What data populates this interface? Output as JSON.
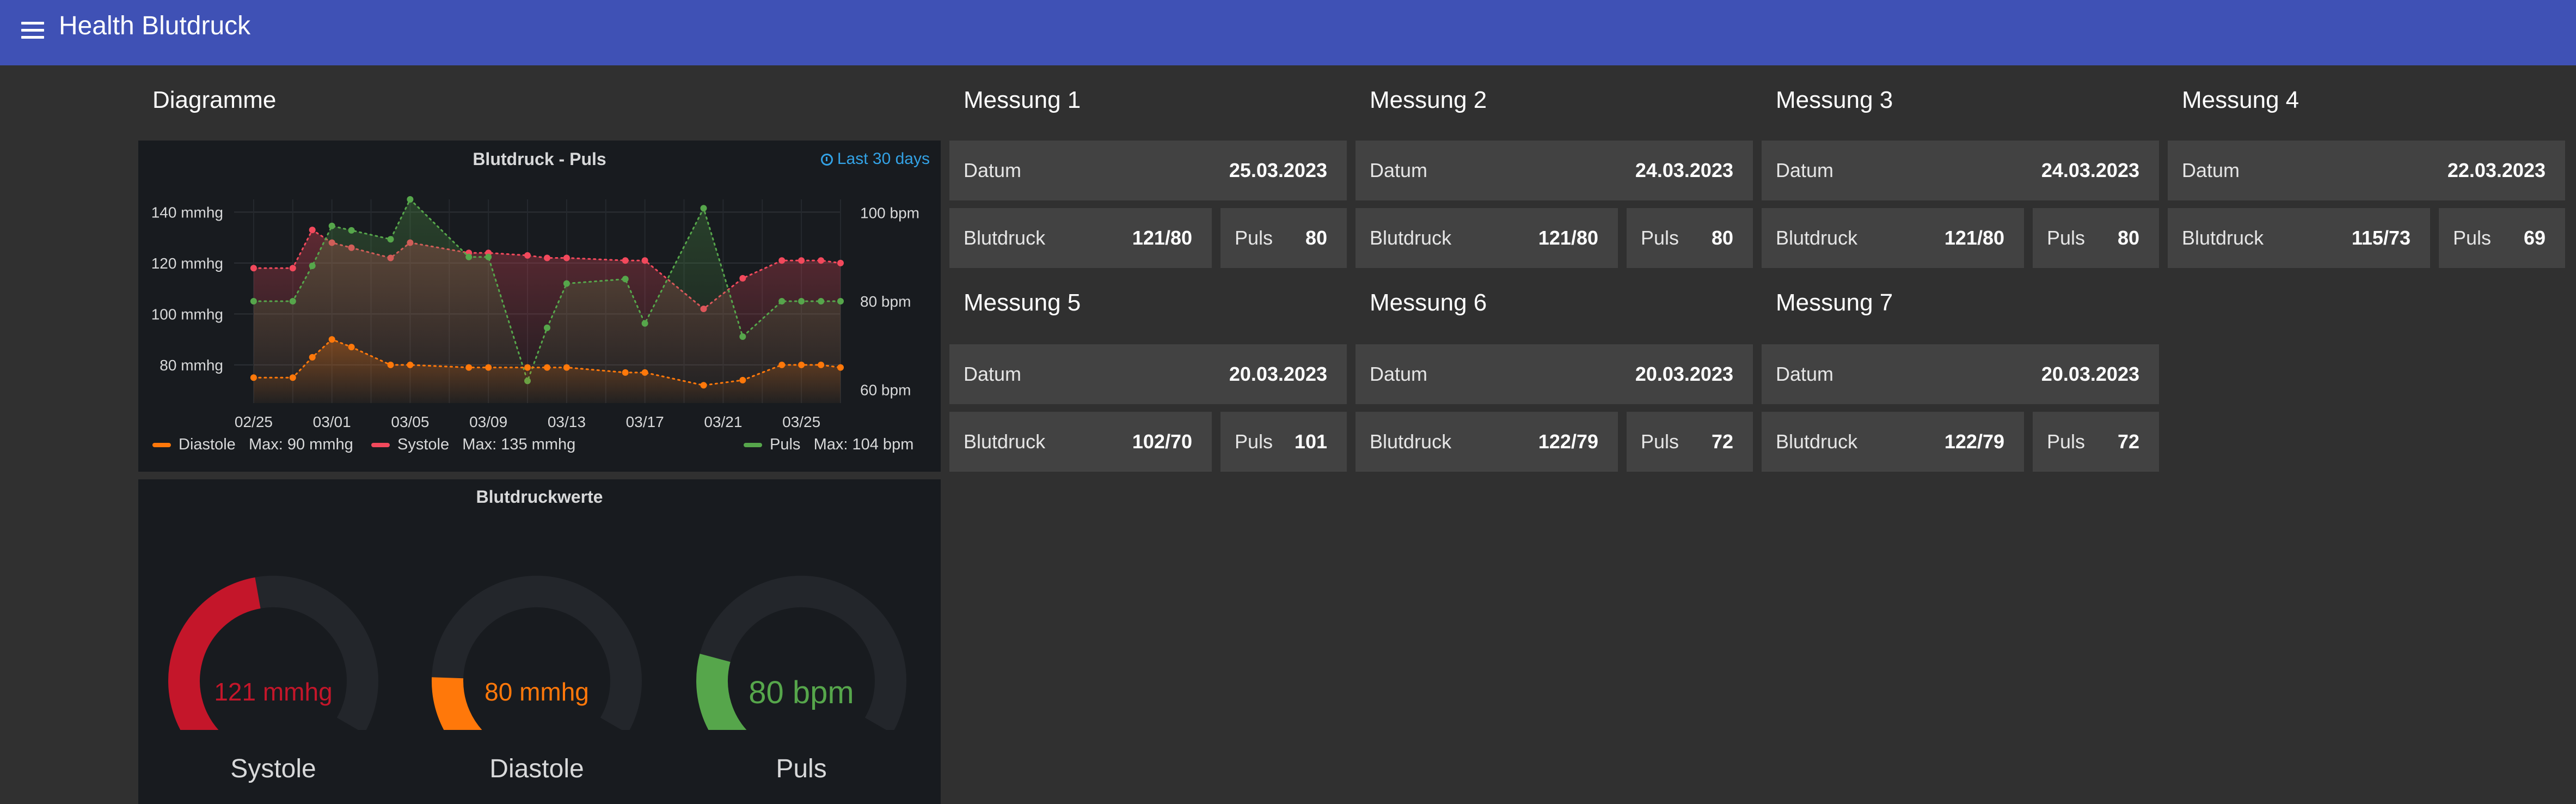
{
  "header": {
    "title": "Health Blutdruck",
    "menu_icon": "menu-icon",
    "color": "#3f51b5"
  },
  "section": {
    "diagrams_title": "Diagramme"
  },
  "chart_panel": {
    "title": "Blutdruck - Puls",
    "time_range": "Last 30 days",
    "legend": [
      {
        "name": "Diastole",
        "max_label": "Max: 90 mmhg",
        "color": "#ff780a"
      },
      {
        "name": "Systole",
        "max_label": "Max: 135 mmhg",
        "color": "#f2495c"
      },
      {
        "name": "Puls",
        "max_label": "Max: 104 bpm",
        "color": "#56a64b"
      }
    ]
  },
  "chart_data": {
    "type": "line",
    "title": "Blutdruck - Puls",
    "x_ticks": [
      "02/25",
      "03/01",
      "03/05",
      "03/09",
      "03/13",
      "03/17",
      "03/21",
      "03/25"
    ],
    "y_left_ticks": [
      "140 mmhg",
      "120 mmhg",
      "100 mmhg",
      "80 mmhg"
    ],
    "y_right_ticks": [
      "100 bpm",
      "80 bpm",
      "60 bpm"
    ],
    "y_left_range": [
      65,
      145
    ],
    "y_right_range": [
      57,
      103
    ],
    "x": [
      "2023-02-25",
      "2023-02-27",
      "2023-02-28",
      "2023-03-01",
      "2023-03-02",
      "2023-03-04",
      "2023-03-05",
      "2023-03-08",
      "2023-03-09",
      "2023-03-11",
      "2023-03-12",
      "2023-03-13",
      "2023-03-16",
      "2023-03-17",
      "2023-03-20",
      "2023-03-22",
      "2023-03-24",
      "2023-03-25",
      "2023-03-26",
      "2023-03-27"
    ],
    "series": [
      {
        "name": "Systole",
        "axis": "left",
        "color": "#f2495c",
        "values": [
          118,
          118,
          133,
          128,
          126,
          122,
          128,
          124,
          124,
          123,
          122,
          122,
          121,
          121,
          102,
          114,
          121,
          121,
          121,
          120
        ]
      },
      {
        "name": "Diastole",
        "axis": "left",
        "color": "#ff780a",
        "values": [
          75,
          75,
          83,
          90,
          87,
          80,
          80,
          79,
          79,
          79,
          79,
          79,
          77,
          77,
          72,
          74,
          80,
          80,
          80,
          79
        ]
      },
      {
        "name": "Puls",
        "axis": "right",
        "color": "#56a64b",
        "values": [
          80,
          80,
          88,
          97,
          96,
          94,
          103,
          90,
          90,
          62,
          74,
          84,
          85,
          75,
          101,
          72,
          80,
          80,
          80,
          80
        ]
      }
    ]
  },
  "gauge_panel": {
    "title": "Blutdruckwerte",
    "gauges": [
      {
        "label": "Systole",
        "value_text": "121 mmhg",
        "fraction": 0.5,
        "color": "#c4162a"
      },
      {
        "label": "Diastole",
        "value_text": "80 mmhg",
        "fraction": 0.2,
        "color": "#ff780a"
      },
      {
        "label": "Puls",
        "value_text": "80 bpm",
        "fraction": 0.25,
        "color": "#56a64b"
      }
    ]
  },
  "measurements": [
    {
      "title": "Messung 1",
      "date_label": "Datum",
      "date": "25.03.2023",
      "bp_label": "Blutdruck",
      "bp": "121/80",
      "pulse_label": "Puls",
      "pulse": "80"
    },
    {
      "title": "Messung 2",
      "date_label": "Datum",
      "date": "24.03.2023",
      "bp_label": "Blutdruck",
      "bp": "121/80",
      "pulse_label": "Puls",
      "pulse": "80"
    },
    {
      "title": "Messung 3",
      "date_label": "Datum",
      "date": "24.03.2023",
      "bp_label": "Blutdruck",
      "bp": "121/80",
      "pulse_label": "Puls",
      "pulse": "80"
    },
    {
      "title": "Messung 4",
      "date_label": "Datum",
      "date": "22.03.2023",
      "bp_label": "Blutdruck",
      "bp": "115/73",
      "pulse_label": "Puls",
      "pulse": "69"
    },
    {
      "title": "Messung 5",
      "date_label": "Datum",
      "date": "20.03.2023",
      "bp_label": "Blutdruck",
      "bp": "102/70",
      "pulse_label": "Puls",
      "pulse": "101"
    },
    {
      "title": "Messung 6",
      "date_label": "Datum",
      "date": "20.03.2023",
      "bp_label": "Blutdruck",
      "bp": "122/79",
      "pulse_label": "Puls",
      "pulse": "72"
    },
    {
      "title": "Messung 7",
      "date_label": "Datum",
      "date": "20.03.2023",
      "bp_label": "Blutdruck",
      "bp": "122/79",
      "pulse_label": "Puls",
      "pulse": "72"
    }
  ]
}
